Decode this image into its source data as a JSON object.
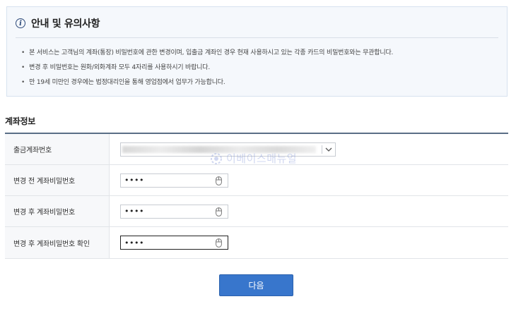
{
  "notice": {
    "title": "안내 및 유의사항",
    "items": [
      "본 서비스는 고객님의 계좌(통장) 비밀번호에 관한 변경이며, 입출금 계좌인 경우 현재 사용하시고 있는 각종 카드의 비밀번호와는 무관합니다.",
      "변경 후 비밀번호는 원화/외화계좌 모두 4자리를 사용하시기 바랍니다.",
      "만 19세 미만인 경우에는 법정대리인을 통해 영업점에서 업무가 가능합니다."
    ]
  },
  "section_title": "계좌정보",
  "form": {
    "account_label": "출금계좌번호",
    "current_pw_label": "변경 전 계좌비밀번호",
    "new_pw_label": "변경 후 계좌비밀번호",
    "confirm_pw_label": "변경 후 계좌비밀번호 확인",
    "current_pw_value": "••••",
    "new_pw_value": "••••",
    "confirm_pw_value": "••••"
  },
  "watermark": "이베이스매뉴얼",
  "next_label": "다음",
  "colors": {
    "accent": "#3876cc",
    "notice_bg": "#f5f8fc",
    "table_top_border": "#5a6e86"
  }
}
